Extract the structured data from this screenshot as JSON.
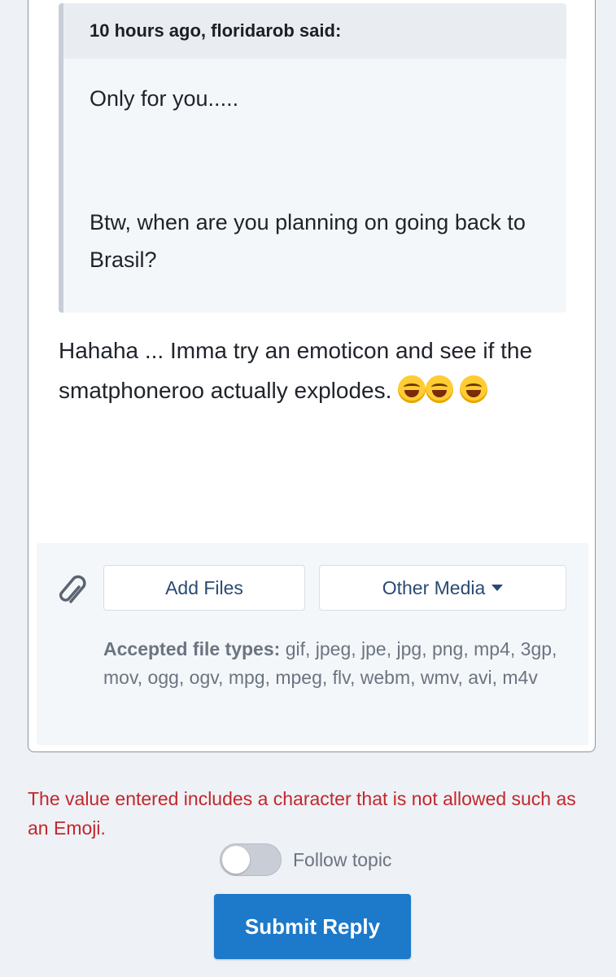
{
  "quote": {
    "header": "10 hours ago, floridarob said:",
    "line1": "Only for you.....",
    "line2": "Btw, when are you planning on going back to Brasil?"
  },
  "reply": {
    "text": "Hahaha ... Imma try an emoticon and see if the smatphoneroo actually explodes.",
    "emojis": [
      "joy-emoji",
      "grinning-sweat-emoji",
      "laughing-emoji"
    ]
  },
  "attachments": {
    "add_files_label": "Add Files",
    "other_media_label": "Other Media",
    "accepted_label": "Accepted file types:",
    "accepted_types": "gif, jpeg, jpe, jpg, png, mp4, 3gp, mov, ogg, ogv, mpg, mpeg, flv, webm, wmv, avi, m4v"
  },
  "error": {
    "message": "The value entered includes a character that is not allowed such as an Emoji."
  },
  "follow": {
    "label": "Follow topic",
    "enabled": false
  },
  "submit": {
    "label": "Submit Reply"
  },
  "colors": {
    "accent": "#1d79c9",
    "error": "#c1272d",
    "link": "#2a4a72"
  }
}
